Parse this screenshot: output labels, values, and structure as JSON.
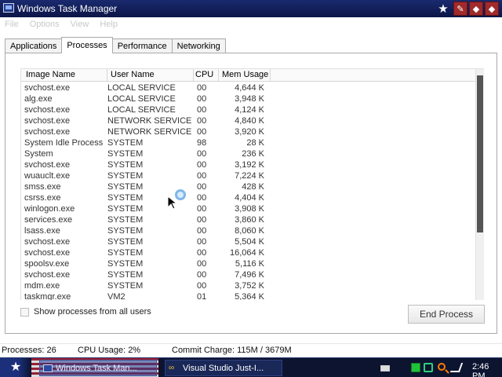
{
  "window": {
    "title": "Windows Task Manager"
  },
  "menu": [
    "File",
    "Options",
    "View",
    "Help"
  ],
  "tabs": [
    {
      "label": "Applications"
    },
    {
      "label": "Processes"
    },
    {
      "label": "Performance"
    },
    {
      "label": "Networking"
    }
  ],
  "active_tab": "Processes",
  "columns": {
    "name": "Image Name",
    "user": "User Name",
    "cpu": "CPU",
    "mem": "Mem Usage"
  },
  "processes": [
    {
      "name": "svchost.exe",
      "user": "LOCAL SERVICE",
      "cpu": "00",
      "mem": "4,644 K"
    },
    {
      "name": "alg.exe",
      "user": "LOCAL SERVICE",
      "cpu": "00",
      "mem": "3,948 K"
    },
    {
      "name": "svchost.exe",
      "user": "LOCAL SERVICE",
      "cpu": "00",
      "mem": "4,124 K"
    },
    {
      "name": "svchost.exe",
      "user": "NETWORK SERVICE",
      "cpu": "00",
      "mem": "4,840 K"
    },
    {
      "name": "svchost.exe",
      "user": "NETWORK SERVICE",
      "cpu": "00",
      "mem": "3,920 K"
    },
    {
      "name": "System Idle Process",
      "user": "SYSTEM",
      "cpu": "98",
      "mem": "28 K"
    },
    {
      "name": "System",
      "user": "SYSTEM",
      "cpu": "00",
      "mem": "236 K"
    },
    {
      "name": "svchost.exe",
      "user": "SYSTEM",
      "cpu": "00",
      "mem": "3,192 K"
    },
    {
      "name": "wuauclt.exe",
      "user": "SYSTEM",
      "cpu": "00",
      "mem": "7,224 K"
    },
    {
      "name": "smss.exe",
      "user": "SYSTEM",
      "cpu": "00",
      "mem": "428 K"
    },
    {
      "name": "csrss.exe",
      "user": "SYSTEM",
      "cpu": "00",
      "mem": "4,404 K"
    },
    {
      "name": "winlogon.exe",
      "user": "SYSTEM",
      "cpu": "00",
      "mem": "3,908 K"
    },
    {
      "name": "services.exe",
      "user": "SYSTEM",
      "cpu": "00",
      "mem": "3,860 K"
    },
    {
      "name": "lsass.exe",
      "user": "SYSTEM",
      "cpu": "00",
      "mem": "8,060 K"
    },
    {
      "name": "svchost.exe",
      "user": "SYSTEM",
      "cpu": "00",
      "mem": "5,504 K"
    },
    {
      "name": "svchost.exe",
      "user": "SYSTEM",
      "cpu": "00",
      "mem": "16,064 K"
    },
    {
      "name": "spoolsv.exe",
      "user": "SYSTEM",
      "cpu": "00",
      "mem": "5,116 K"
    },
    {
      "name": "svchost.exe",
      "user": "SYSTEM",
      "cpu": "00",
      "mem": "7,496 K"
    },
    {
      "name": "mdm.exe",
      "user": "SYSTEM",
      "cpu": "00",
      "mem": "3,752 K"
    },
    {
      "name": "taskmgr.exe",
      "user": "VM2",
      "cpu": "01",
      "mem": "5,364 K"
    }
  ],
  "show_all_label": "Show processes from all users",
  "end_process_label": "End Process",
  "status": {
    "processes": "Processes: 26",
    "cpu": "CPU Usage: 2%",
    "commit": "Commit Charge: 115M / 3679M"
  },
  "taskbar": {
    "start_icon": "star-icon",
    "tasks": [
      {
        "label": "Windows Task Man...",
        "icon": "task-manager-icon"
      },
      {
        "label": "Visual Studio Just-I...",
        "icon": "visual-studio-icon"
      }
    ],
    "clock": "2:46 PM"
  }
}
